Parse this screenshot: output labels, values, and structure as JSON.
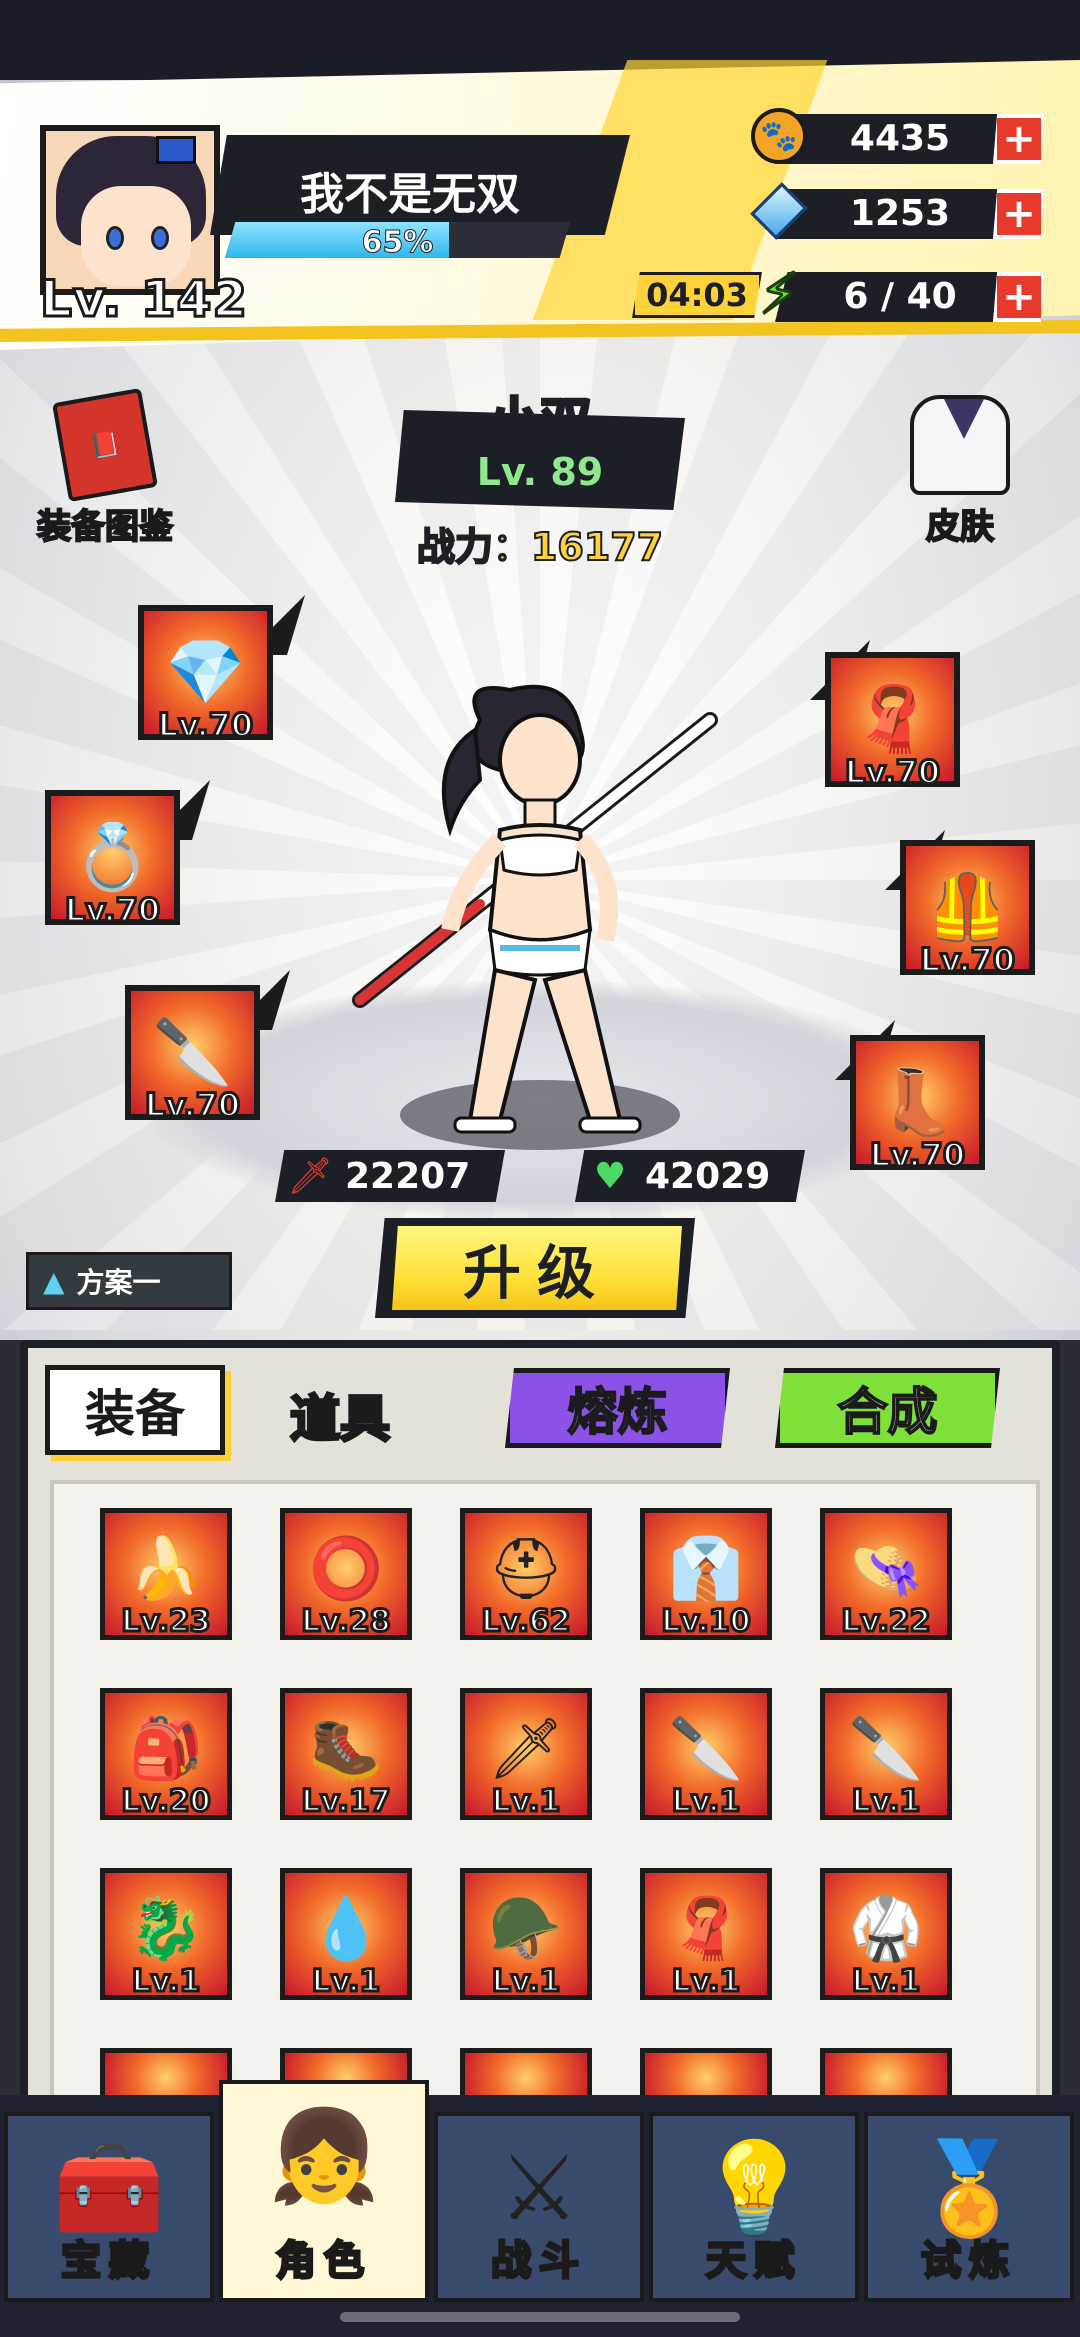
{
  "header": {
    "player_name": "我不是无双",
    "player_level": "Lv. 142",
    "xp_percent_label": "65%",
    "xp_fraction": 0.65,
    "coins": "4435",
    "gems": "1253",
    "energy_timer": "04:03",
    "energy": "6 / 40",
    "plus_glyph": "+"
  },
  "side": {
    "codex_label": "装备图鉴",
    "skin_label": "皮肤"
  },
  "hero": {
    "name": "小双",
    "level": "Lv. 89",
    "power": "战力：16177",
    "attack": "22207",
    "hp": "42029"
  },
  "equipped": {
    "necklace": "Lv.70",
    "ring": "Lv.70",
    "weapon": "Lv.70",
    "scarf": "Lv.70",
    "armor": "Lv.70",
    "boots": "Lv.70"
  },
  "actions": {
    "plan": "方案一",
    "upgrade": "升级"
  },
  "tabs": {
    "equip": "装备",
    "items": "道具",
    "smelt": "熔炼",
    "craft": "合成"
  },
  "inventory": [
    {
      "icon": "banana-blade-icon",
      "glyph": "🍌",
      "level": "Lv.23"
    },
    {
      "icon": "dark-ring-icon",
      "glyph": "⭕",
      "level": "Lv.28"
    },
    {
      "icon": "helmet-icon",
      "glyph": "⛑",
      "level": "Lv.62"
    },
    {
      "icon": "sailor-collar-icon",
      "glyph": "👔",
      "level": "Lv.10"
    },
    {
      "icon": "safari-hat-icon",
      "glyph": "👒",
      "level": "Lv.22"
    },
    {
      "icon": "backpack-icon",
      "glyph": "🎒",
      "level": "Lv.20"
    },
    {
      "icon": "boot-icon",
      "glyph": "🥾",
      "level": "Lv.17"
    },
    {
      "icon": "red-sword-icon",
      "glyph": "🗡",
      "level": "Lv.1"
    },
    {
      "icon": "ice-blade-icon",
      "glyph": "🔪",
      "level": "Lv.1"
    },
    {
      "icon": "machete-icon",
      "glyph": "🔪",
      "level": "Lv.1"
    },
    {
      "icon": "dragon-ring-icon",
      "glyph": "🐉",
      "level": "Lv.1"
    },
    {
      "icon": "jade-pendant-icon",
      "glyph": "💧",
      "level": "Lv.1"
    },
    {
      "icon": "pink-helmet-icon",
      "glyph": "🪖",
      "level": "Lv.1"
    },
    {
      "icon": "blue-scarf-icon",
      "glyph": "🧣",
      "level": "Lv.1"
    },
    {
      "icon": "martial-uniform-icon",
      "glyph": "🥋",
      "level": "Lv.1"
    }
  ],
  "nav": [
    {
      "label": "宝藏",
      "icon": "treasure-chest-icon",
      "glyph": "🧰"
    },
    {
      "label": "角色",
      "icon": "character-portrait-icon",
      "glyph": "👧"
    },
    {
      "label": "战斗",
      "icon": "crossed-swords-icon",
      "glyph": "⚔"
    },
    {
      "label": "天赋",
      "icon": "lightbulb-icon",
      "glyph": "💡"
    },
    {
      "label": "试炼",
      "icon": "trial-emblem-icon",
      "glyph": "🏅"
    }
  ]
}
